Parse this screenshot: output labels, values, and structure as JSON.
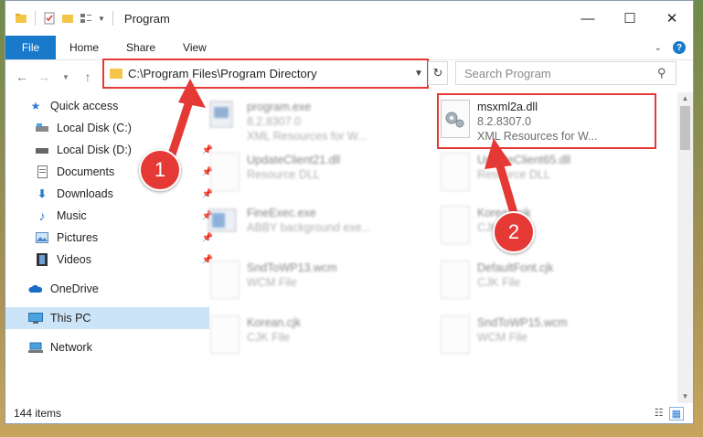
{
  "window": {
    "title": "Program",
    "controls": {
      "minimize": "—",
      "maximize": "☐",
      "close": "✕"
    }
  },
  "ribbon": {
    "file": "File",
    "tabs": [
      "Home",
      "Share",
      "View"
    ]
  },
  "address": {
    "path": "C:\\Program Files\\Program Directory"
  },
  "search": {
    "placeholder": "Search Program"
  },
  "sidebar": {
    "items": [
      {
        "label": "Quick access",
        "icon": "star-icon"
      },
      {
        "label": "Local Disk (C:)",
        "icon": "drive-icon"
      },
      {
        "label": "Local Disk (D:)",
        "icon": "drive-icon"
      },
      {
        "label": "Documents",
        "icon": "documents-icon"
      },
      {
        "label": "Downloads",
        "icon": "download-icon"
      },
      {
        "label": "Music",
        "icon": "music-icon"
      },
      {
        "label": "Pictures",
        "icon": "pictures-icon"
      },
      {
        "label": "Videos",
        "icon": "videos-icon"
      },
      {
        "label": "OneDrive",
        "icon": "cloud-icon"
      },
      {
        "label": "This PC",
        "icon": "computer-icon"
      },
      {
        "label": "Network",
        "icon": "network-icon"
      }
    ]
  },
  "files": [
    {
      "name": "program.exe",
      "desc": "8.2.8307.0",
      "desc2": "XML Resources for W..."
    },
    {
      "name": "msxml2a.dll",
      "desc": "8.2.8307.0",
      "desc2": "XML Resources for W..."
    },
    {
      "name": "UpdateClient21.dll",
      "desc": "Resource DLL"
    },
    {
      "name": "UpdateClient65.dll",
      "desc": "Resource DLL"
    },
    {
      "name": "FineExec.exe",
      "desc": "ABBY background exe..."
    },
    {
      "name": "Korean.cjk",
      "desc": "CJK File"
    },
    {
      "name": "SndToWP13.wcm",
      "desc": "WCM File"
    },
    {
      "name": "DefaultFont.cjk",
      "desc": "CJK File"
    },
    {
      "name": "Korean.cjk",
      "desc": "CJK File"
    },
    {
      "name": "SndToWP15.wcm",
      "desc": "WCM File"
    }
  ],
  "status": {
    "count": "144 items"
  },
  "annotations": {
    "step1": "1",
    "step2": "2",
    "color": "#e53935"
  }
}
